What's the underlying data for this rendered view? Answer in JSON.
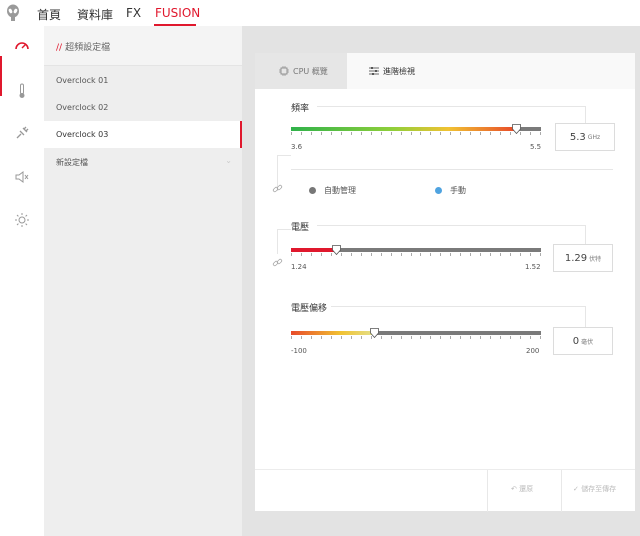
{
  "nav": {
    "items": [
      {
        "label": "首頁"
      },
      {
        "label": "資料庫"
      },
      {
        "label": "FX"
      },
      {
        "label": "FUSION"
      }
    ]
  },
  "rail": {
    "icons": [
      "gauge-icon",
      "thermometer-icon",
      "plug-icon",
      "speaker-icon",
      "brightness-icon"
    ]
  },
  "profiles": {
    "title": "超頻設定檔",
    "items": [
      {
        "label": "Overclock 01"
      },
      {
        "label": "Overclock 02"
      },
      {
        "label": "Overclock 03"
      },
      {
        "label": "新設定檔"
      }
    ],
    "selected": "Overclock 03"
  },
  "tabs": [
    {
      "label": "CPU 概覽"
    },
    {
      "label": "進階檢視"
    }
  ],
  "frequency": {
    "label": "頻率",
    "min": "3.6",
    "max": "5.5",
    "value": "5.3",
    "unit": "GHz",
    "position": 0.9
  },
  "mode": {
    "auto": "自動管理",
    "manual": "手動"
  },
  "voltage": {
    "label": "電壓",
    "min": "1.24",
    "max": "1.52",
    "value": "1.29",
    "unit": "伏特",
    "position": 0.18
  },
  "offset": {
    "label": "電壓偏移",
    "min": "-100",
    "max": "200",
    "value": "0",
    "unit": "毫伏",
    "position": 0.333
  },
  "footer": {
    "restore": "還原",
    "save": "儲存至傳存"
  },
  "colors": {
    "accent": "#e0182d",
    "manual_dot": "#4fa3e0",
    "auto_dot": "#777777"
  }
}
